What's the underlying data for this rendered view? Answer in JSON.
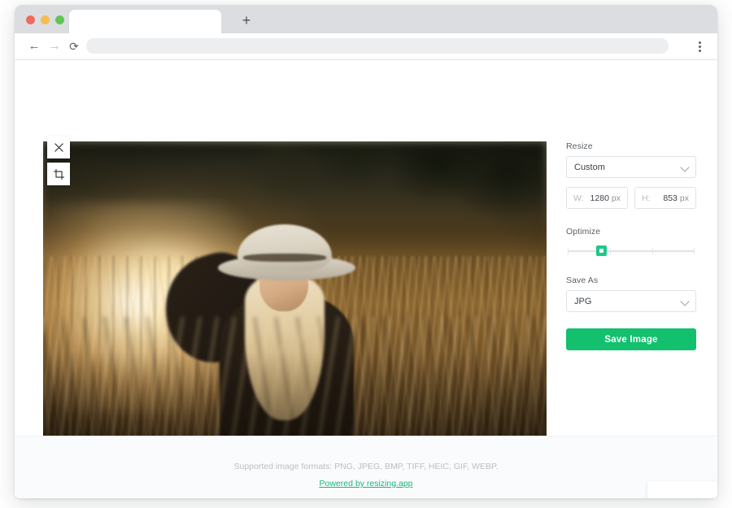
{
  "browser": {
    "tab_title": "",
    "address_value": "",
    "address_placeholder": "",
    "new_tab_label": "+",
    "back_icon": "back-arrow-icon",
    "forward_icon": "forward-arrow-icon",
    "reload_icon": "reload-icon",
    "menu_icon": "three-dot-menu-icon"
  },
  "editor": {
    "close_label": "✕",
    "crop_icon": "crop-icon",
    "photo_alt": "Blonde woman in a fedora hat standing in a sunlit tall-grass field at golden hour"
  },
  "panel": {
    "resize": {
      "label": "Resize",
      "preset": "Custom",
      "width": {
        "key": "W:",
        "value": "1280",
        "unit": "px"
      },
      "height": {
        "key": "H:",
        "value": "853",
        "unit": "px"
      }
    },
    "optimize": {
      "label": "Optimize",
      "value_percent": 25
    },
    "save_as": {
      "label": "Save As",
      "format": "JPG"
    },
    "save_button": "Save Image"
  },
  "footer": {
    "formats": "Supported image formats: PNG, JPEG, BMP, TIFF, HEIC, GIF, WEBP.",
    "powered_by": "Powered by resizing.app"
  },
  "colors": {
    "accent_green": "#12c06e",
    "slider_green": "#1ec88a",
    "link_green": "#18b77e",
    "tabbar_grey": "#dcdde0"
  }
}
